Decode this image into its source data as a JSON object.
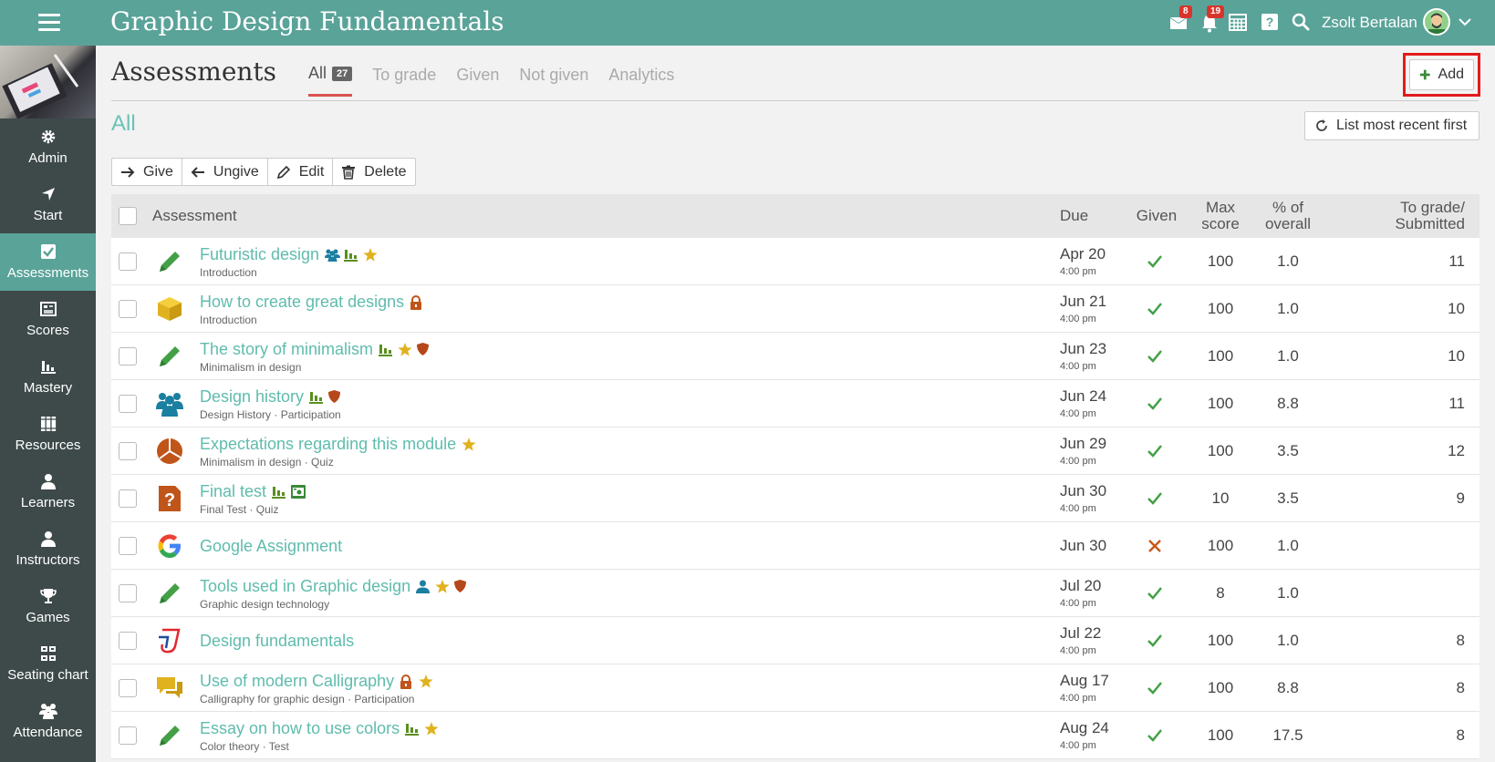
{
  "header": {
    "course_title": "Graphic Design Fundamentals",
    "messages_badge": "8",
    "notifications_badge": "19",
    "user_name": "Zsolt Bertalan"
  },
  "colors": {
    "accent": "#5aa399",
    "link": "#5fbcad",
    "check": "#43a047",
    "cross": "#c85a1a",
    "highlight": "#e31b1b"
  },
  "sidebar": {
    "items": [
      {
        "label": "Admin",
        "icon": "gear-icon"
      },
      {
        "label": "Start",
        "icon": "navigate-arrow-icon"
      },
      {
        "label": "Assessments",
        "icon": "checkbox-icon",
        "active": true
      },
      {
        "label": "Scores",
        "icon": "gradebook-icon"
      },
      {
        "label": "Mastery",
        "icon": "bar-chart-icon"
      },
      {
        "label": "Resources",
        "icon": "books-icon"
      },
      {
        "label": "Learners",
        "icon": "person-icon"
      },
      {
        "label": "Instructors",
        "icon": "person-icon"
      },
      {
        "label": "Games",
        "icon": "trophy-icon"
      },
      {
        "label": "Seating chart",
        "icon": "seating-icon"
      },
      {
        "label": "Attendance",
        "icon": "group-icon"
      }
    ]
  },
  "page": {
    "title": "Assessments",
    "tabs": [
      {
        "label": "All",
        "count": "27",
        "active": true
      },
      {
        "label": "To grade"
      },
      {
        "label": "Given"
      },
      {
        "label": "Not given"
      },
      {
        "label": "Analytics"
      }
    ],
    "add_label": "Add",
    "section_title": "All",
    "sort_label": "List most recent first",
    "actions": {
      "give": "Give",
      "ungive": "Ungive",
      "edit": "Edit",
      "delete": "Delete"
    }
  },
  "table": {
    "headers": {
      "assessment": "Assessment",
      "due": "Due",
      "given": "Given",
      "max_score_1": "Max",
      "max_score_2": "score",
      "pct_1": "% of",
      "pct_2": "overall",
      "tograde_1": "To grade/",
      "tograde_2": "Submitted"
    },
    "rows": [
      {
        "title": "Futuristic design",
        "subtitle": "Introduction",
        "due_date": "Apr 20",
        "due_time": "4:00 pm",
        "given": true,
        "max": "100",
        "pct": "1.0",
        "to_grade": "11",
        "icon": "pencil-icon",
        "tags": [
          "group-tag-icon",
          "analytics-tag-icon",
          "star-tag-icon"
        ]
      },
      {
        "title": "How to create great designs",
        "subtitle": "Introduction",
        "due_date": "Jun 21",
        "due_time": "4:00 pm",
        "given": true,
        "max": "100",
        "pct": "1.0",
        "to_grade": "10",
        "icon": "box-icon",
        "tags": [
          "lock-tag-icon"
        ]
      },
      {
        "title": "The story of minimalism",
        "subtitle": "Minimalism in design",
        "due_date": "Jun 23",
        "due_time": "4:00 pm",
        "given": true,
        "max": "100",
        "pct": "1.0",
        "to_grade": "10",
        "icon": "pencil-icon",
        "tags": [
          "analytics-tag-icon",
          "star-tag-icon",
          "shield-tag-icon"
        ]
      },
      {
        "title": "Design history",
        "subtitle": "Design History · Participation",
        "due_date": "Jun 24",
        "due_time": "4:00 pm",
        "given": true,
        "max": "100",
        "pct": "8.8",
        "to_grade": "11",
        "icon": "people-icon",
        "tags": [
          "analytics-tag-icon",
          "shield-tag-icon"
        ]
      },
      {
        "title": "Expectations regarding this module",
        "subtitle": "Minimalism in design · Quiz",
        "due_date": "Jun 29",
        "due_time": "4:00 pm",
        "given": true,
        "max": "100",
        "pct": "3.5",
        "to_grade": "12",
        "icon": "pie-icon",
        "tags": [
          "star-tag-icon"
        ]
      },
      {
        "title": "Final test",
        "subtitle": "Final Test · Quiz",
        "due_date": "Jun 30",
        "due_time": "4:00 pm",
        "given": true,
        "max": "10",
        "pct": "3.5",
        "to_grade": "9",
        "icon": "question-doc-icon",
        "tags": [
          "analytics-tag-icon",
          "camera-tag-icon"
        ]
      },
      {
        "title": "Google Assignment",
        "subtitle": "",
        "due_date": "Jun 30",
        "due_time": "",
        "given": false,
        "max": "100",
        "pct": "1.0",
        "to_grade": "",
        "icon": "google-icon",
        "tags": []
      },
      {
        "title": "Tools used in Graphic design",
        "subtitle": "Graphic design technology",
        "due_date": "Jul 20",
        "due_time": "4:00 pm",
        "given": true,
        "max": "8",
        "pct": "1.0",
        "to_grade": "",
        "icon": "pencil-icon",
        "tags": [
          "person-tag-icon",
          "star-tag-icon",
          "shield-tag-icon"
        ]
      },
      {
        "title": "Design fundamentals",
        "subtitle": "",
        "due_date": "Jul 22",
        "due_time": "4:00 pm",
        "given": true,
        "max": "100",
        "pct": "1.0",
        "to_grade": "8",
        "icon": "app-logo-icon",
        "tags": []
      },
      {
        "title": "Use of modern Calligraphy",
        "subtitle": "Calligraphy for graphic design · Participation",
        "due_date": "Aug 17",
        "due_time": "4:00 pm",
        "given": true,
        "max": "100",
        "pct": "8.8",
        "to_grade": "8",
        "icon": "chat-icon",
        "tags": [
          "lock-tag-icon",
          "star-tag-icon"
        ]
      },
      {
        "title": "Essay on how to use colors",
        "subtitle": "Color theory · Test",
        "due_date": "Aug 24",
        "due_time": "4:00 pm",
        "given": true,
        "max": "100",
        "pct": "17.5",
        "to_grade": "8",
        "icon": "pencil-icon",
        "tags": [
          "analytics-tag-icon",
          "star-tag-icon"
        ]
      }
    ]
  }
}
